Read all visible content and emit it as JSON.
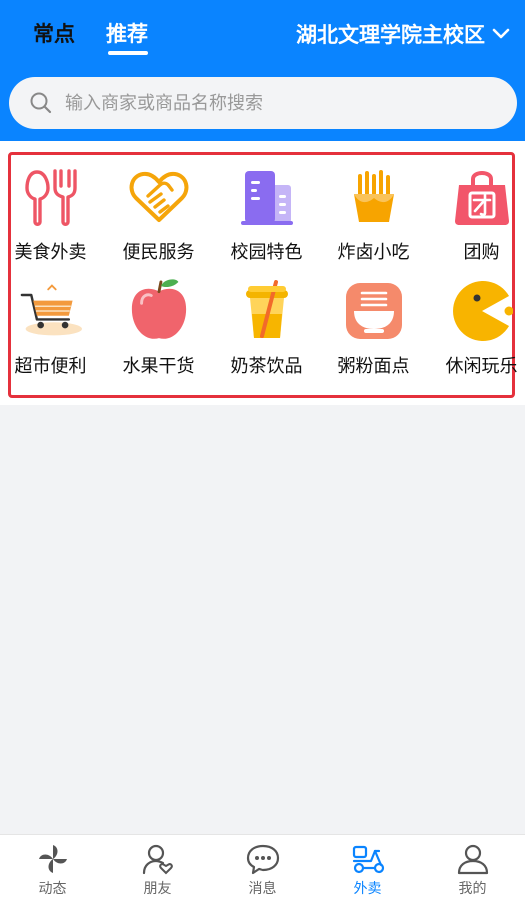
{
  "header": {
    "tabs": [
      {
        "label": "常点",
        "active": false
      },
      {
        "label": "推荐",
        "active": true
      }
    ],
    "campus": "湖北文理学院主校区",
    "search_placeholder": "输入商家或商品名称搜索"
  },
  "categories": [
    {
      "label": "美食外卖",
      "icon": "fork-knife-icon"
    },
    {
      "label": "便民服务",
      "icon": "heart-handshake-icon"
    },
    {
      "label": "校园特色",
      "icon": "building-icon"
    },
    {
      "label": "炸卤小吃",
      "icon": "fries-icon"
    },
    {
      "label": "团购",
      "icon": "group-buy-bag-icon"
    },
    {
      "label": "超市便利",
      "icon": "shopping-cart-icon"
    },
    {
      "label": "水果干货",
      "icon": "apple-icon"
    },
    {
      "label": "奶茶饮品",
      "icon": "milk-tea-icon"
    },
    {
      "label": "粥粉面点",
      "icon": "noodle-bowl-icon"
    },
    {
      "label": "休闲玩乐",
      "icon": "pacman-icon"
    }
  ],
  "bottom_nav": [
    {
      "label": "动态",
      "icon": "pinwheel-icon",
      "active": false
    },
    {
      "label": "朋友",
      "icon": "friend-icon",
      "active": false
    },
    {
      "label": "消息",
      "icon": "chat-bubble-icon",
      "active": false
    },
    {
      "label": "外卖",
      "icon": "scooter-icon",
      "active": true
    },
    {
      "label": "我的",
      "icon": "profile-icon",
      "active": false
    }
  ],
  "colors": {
    "brand_blue": "#0a84ff",
    "highlight_red": "#e5313c",
    "page_bg": "#f2f3f5"
  }
}
